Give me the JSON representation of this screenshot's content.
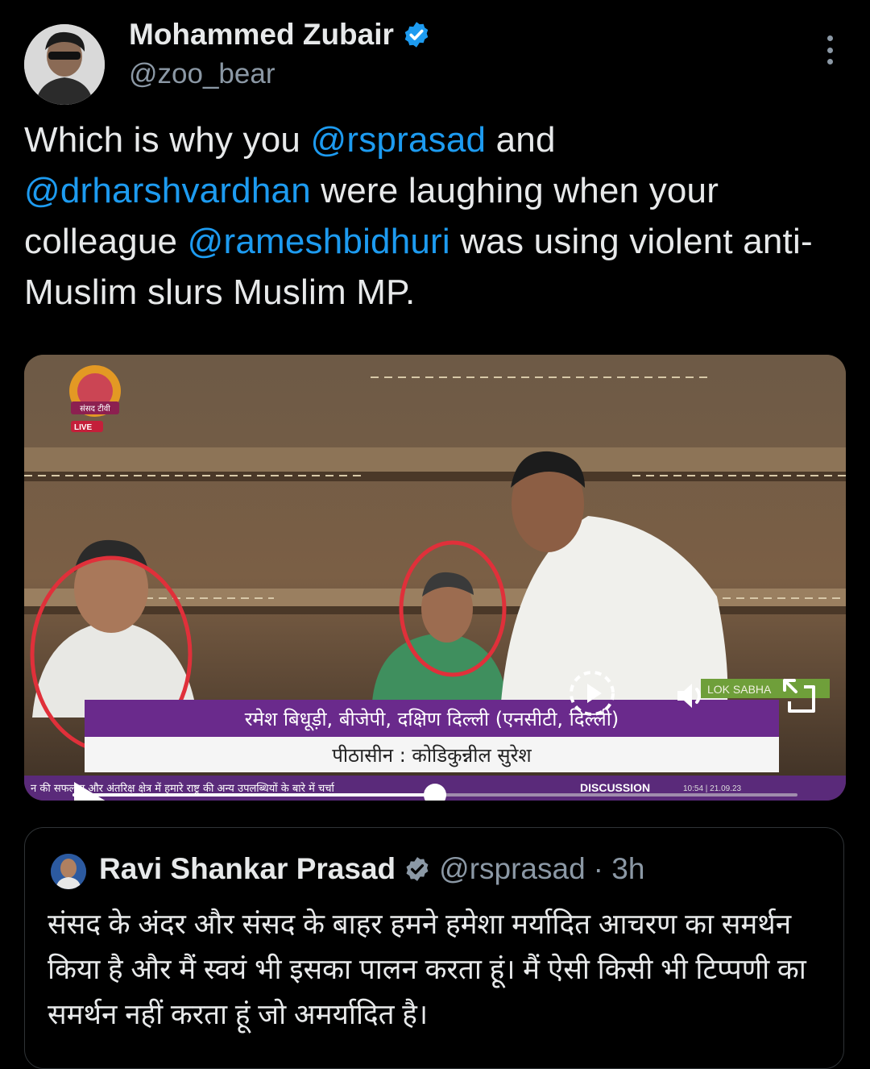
{
  "author": {
    "name": "Mohammed Zubair",
    "handle": "@zoo_bear"
  },
  "tweet": {
    "segments": [
      {
        "text": "Which is why you ",
        "mention": false
      },
      {
        "text": "@rsprasad",
        "mention": true
      },
      {
        "text": " and ",
        "mention": false
      },
      {
        "text": "@drharshvardhan",
        "mention": true
      },
      {
        "text": " were laughing when your colleague ",
        "mention": false
      },
      {
        "text": "@rameshbidhuri",
        "mention": true
      },
      {
        "text": " was using violent anti-Muslim slurs  Muslim MP.",
        "mention": false
      }
    ]
  },
  "media": {
    "channel_logo_text": "संसद टीवी",
    "live_label": "LIVE",
    "chyron_line1": "रमेश बिधूड़ी, बीजेपी, दक्षिण दिल्ली (एनसीटी, दिल्ली)",
    "chyron_line2": "पीठासीन : कोडिकुन्नील सुरेश",
    "ticker_text": "न की सफलता और अंतरिक्ष क्षेत्र में हमारे राष्ट्र की अन्य उपलब्धियों के बारे में चर्चा",
    "ticker_label": "DISCUSSION",
    "ticker_time": "10:54 | 21.09.23",
    "lok_sabha_label": "LOK SABHA",
    "progress": 0.5
  },
  "quoted": {
    "name": "Ravi Shankar Prasad",
    "handle": "@rsprasad",
    "time": "· 3h",
    "text": "संसद के अंदर और संसद के बाहर हमने हमेशा मर्यादित आचरण का समर्थन किया है और मैं स्वयं भी इसका पालन करता हूं। मैं ऐसी किसी भी टिप्पणी का समर्थन नहीं करता हूं जो अमर्यादित है।"
  },
  "colors": {
    "accent": "#1d9bf0",
    "verified": "#1d9bf0",
    "muted": "#8b98a5",
    "circle": "#e0303a"
  }
}
